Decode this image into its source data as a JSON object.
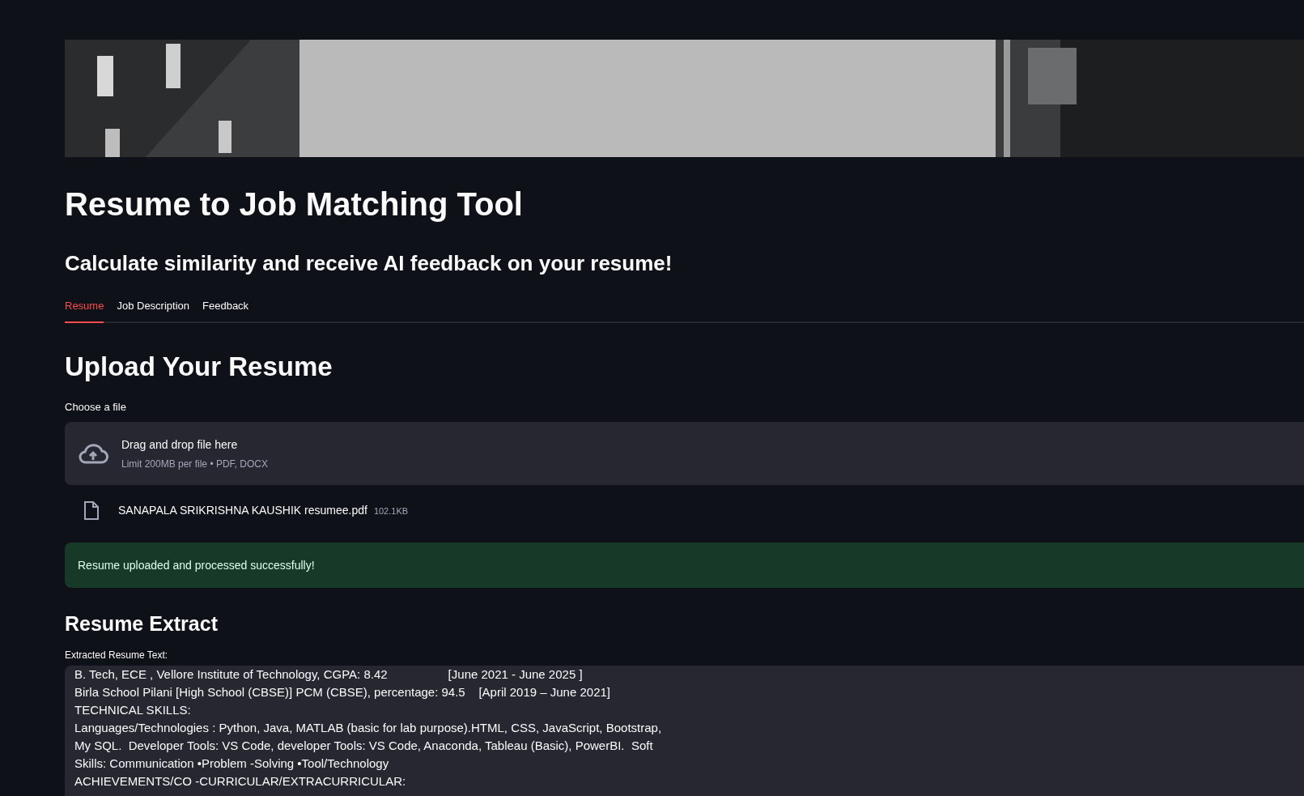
{
  "title": "Resume to Job Matching Tool",
  "subtitle": "Calculate similarity and receive AI feedback on your resume!",
  "tabs": [
    {
      "label": "Resume",
      "selected": true
    },
    {
      "label": "Job Description",
      "selected": false
    },
    {
      "label": "Feedback",
      "selected": false
    }
  ],
  "upload": {
    "heading": "Upload Your Resume",
    "label": "Choose a file",
    "dropzone_title": "Drag and drop file here",
    "dropzone_hint": "Limit 200MB per file • PDF, DOCX",
    "file": {
      "name": "SANAPALA SRIKRISHNA KAUSHIK resumee.pdf",
      "size": "102.1KB"
    }
  },
  "alert": {
    "kind": "success",
    "text": "Resume uploaded and processed successfully!"
  },
  "extract": {
    "heading": "Resume Extract",
    "label": "Extracted Resume Text:",
    "lines": [
      "B. Tech, ECE , Vellore Institute of Technology, CGPA: 8.42                  [June 2021 - June 2025 ]",
      "Birla School Pilani [High School (CBSE)] PCM (CBSE), percentage: 94.5    [April 2019 – June 2021]",
      "TECHNICAL SKILLS:",
      "Languages/Technologies : Python, Java, MATLAB (basic for lab purpose).HTML, CSS, JavaScript, Bootstrap,",
      "My SQL.  Developer Tools: VS Code, developer Tools: VS Code, Anaconda, Tableau (Basic), PowerBI.  Soft",
      "Skills: Communication •Problem -Solving •Tool/Technology",
      "ACHIEVEMENTS/CO -CURRICULAR/EXTRACURRICULAR:"
    ]
  }
}
